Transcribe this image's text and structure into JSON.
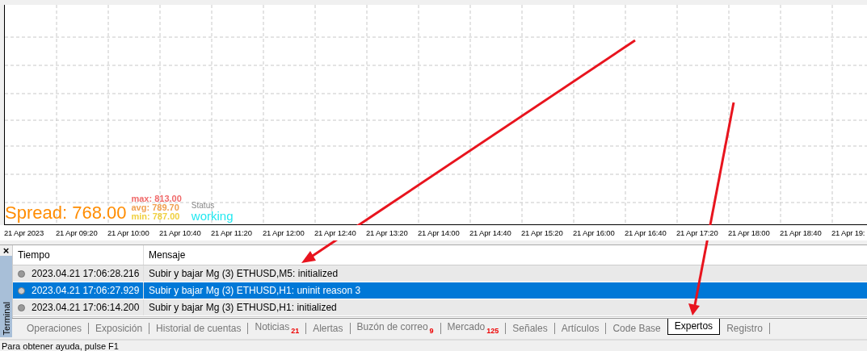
{
  "chart": {
    "spread": "Spread: 768.00",
    "stats": [
      {
        "label": "max: 813.00",
        "color": "#f06a6a"
      },
      {
        "label": "avg: 789.70",
        "color": "#f0a050"
      },
      {
        "label": "min: 787.00",
        "color": "#f0d040"
      }
    ],
    "status_label": "Status",
    "status_value": "working",
    "x_labels": [
      "21 Apr 2023",
      "21 Apr 09:20",
      "21 Apr 10:00",
      "21 Apr 10:40",
      "21 Apr 11:20",
      "21 Apr 12:00",
      "21 Apr 12:40",
      "21 Apr 13:20",
      "21 Apr 14:00",
      "21 Apr 14:40",
      "21 Apr 15:20",
      "21 Apr 16:00",
      "21 Apr 16:40",
      "21 Apr 17:20",
      "21 Apr 18:00",
      "21 Apr 18:40",
      "21 Apr 19:"
    ]
  },
  "terminal": {
    "title": "Terminal",
    "close": "×",
    "columns": [
      "Tiempo",
      "Mensaje"
    ],
    "rows": [
      {
        "time": "2023.04.21 17:06:28.216",
        "message": "Subir y bajar Mg (3) ETHUSD,M5: initialized",
        "selected": false
      },
      {
        "time": "2023.04.21 17:06:27.929",
        "message": "Subir y bajar Mg (3) ETHUSD,H1: uninit reason 3",
        "selected": true
      },
      {
        "time": "2023.04.21 17:06:14.200",
        "message": "Subir y bajar Mg (3) ETHUSD,H1: initialized",
        "selected": false
      }
    ],
    "tabs": [
      {
        "label": "Operaciones",
        "selected": false
      },
      {
        "label": "Exposición",
        "selected": false
      },
      {
        "label": "Historial de cuentas",
        "selected": false
      },
      {
        "label": "Noticias",
        "badge": "21",
        "selected": false
      },
      {
        "label": "Alertas",
        "selected": false
      },
      {
        "label": "Buzón de correo",
        "badge": "9",
        "selected": false
      },
      {
        "label": "Mercado",
        "badge": "125",
        "selected": false
      },
      {
        "label": "Señales",
        "selected": false
      },
      {
        "label": "Artículos",
        "selected": false
      },
      {
        "label": "Code Base",
        "selected": false
      },
      {
        "label": "Expertos",
        "selected": true
      },
      {
        "label": "Registro",
        "selected": false
      }
    ]
  },
  "status_bar": "Para obtener ayuda, pulse F1"
}
